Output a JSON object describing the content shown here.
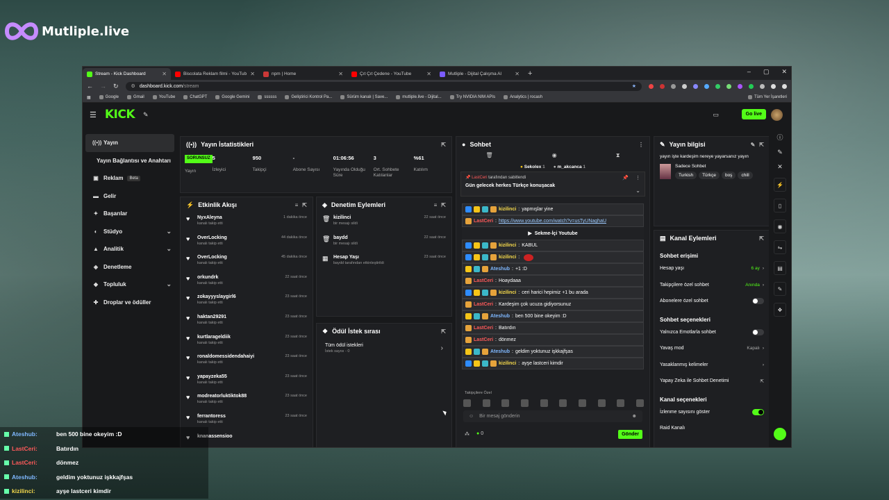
{
  "brand": {
    "name": "Mutliple.live"
  },
  "browser": {
    "tabs": [
      {
        "label": "Stream - Kick Dashboard",
        "color": "#53fc18",
        "active": true
      },
      {
        "label": "Biscolata Reklam filmi - YouTub",
        "color": "#ff0000",
        "active": false
      },
      {
        "label": "npm | Home",
        "color": "#cb3837",
        "active": false
      },
      {
        "label": "Çıt Çıt Çedene - YouTube",
        "color": "#ff0000",
        "active": false
      },
      {
        "label": "Mutliple - Dijital Çalışma Al",
        "color": "#7b5cff",
        "active": false
      }
    ],
    "url": "dashboard.kick.com",
    "url_path": "/stream",
    "bookmarks": [
      "Google",
      "Gmail",
      "YouTube",
      "ChatGPT",
      "Google Gemini",
      "ssssss",
      "Geliştirici Kontrol Pa...",
      "Sürüm kanalı | Save...",
      "mutliple.live - Dijital...",
      "Try NVIDIA NIM APIs",
      "Analytics | rocash"
    ],
    "bookmarks_all": "Tüm Yer İşaretleri"
  },
  "kick": {
    "logo": "KICK",
    "golive": "Go live",
    "sidebar": [
      {
        "label": "Yayın",
        "icon": "broadcast-icon",
        "active": true
      },
      {
        "label": "Yayın Bağlantısı ve Anahtarı",
        "icon": "",
        "active": false
      },
      {
        "label": "Reklam",
        "icon": "ad-icon",
        "beta": "Beta"
      },
      {
        "label": "Gelir",
        "icon": "revenue-icon"
      },
      {
        "label": "Başarılar",
        "icon": "achievement-icon"
      },
      {
        "label": "Stüdyo",
        "icon": "studio-icon",
        "chev": true
      },
      {
        "label": "Analitik",
        "icon": "analytics-icon",
        "chev": true
      },
      {
        "label": "Denetleme",
        "icon": "moderation-icon"
      },
      {
        "label": "Topluluk",
        "icon": "community-icon",
        "chev": true
      },
      {
        "label": "Droplar ve ödüller",
        "icon": "drops-icon"
      }
    ]
  },
  "stats": {
    "title": "Yayın İstatistikleri",
    "badge": "SORUNSUZ",
    "badge_label": "Yayın",
    "items": [
      {
        "value": "5",
        "label": "İzleyici"
      },
      {
        "value": "950",
        "label": "Takipçi"
      },
      {
        "value": "-",
        "label": "Abone Sayısı"
      },
      {
        "value": "01:06:56",
        "label": "Yayında Olduğu Süre"
      },
      {
        "value": "3",
        "label": "Ort. Sohbete Katılanlar"
      },
      {
        "value": "%61",
        "label": "Katılım"
      }
    ]
  },
  "activity": {
    "title": "Etkinlik Akışı",
    "items": [
      {
        "name": "NyxAleyna",
        "sub": "kanalı takip etti",
        "time": "1 dakika önce"
      },
      {
        "name": "OverLocking",
        "sub": "kanalı takip etti",
        "time": "44 dakika önce"
      },
      {
        "name": "OverLocking",
        "sub": "kanalı takip etti",
        "time": "45 dakika önce"
      },
      {
        "name": "orkundrk",
        "sub": "kanalı takip etti",
        "time": "22 saat önce"
      },
      {
        "name": "zokayyyslaygirl6",
        "sub": "kanalı takip etti",
        "time": "23 saat önce"
      },
      {
        "name": "haktan29291",
        "sub": "kanalı takip etti",
        "time": "23 saat önce"
      },
      {
        "name": "kurtlarageldiik",
        "sub": "kanalı takip etti",
        "time": "23 saat önce"
      },
      {
        "name": "ronaldomessidendahaiyi",
        "sub": "kanalı takip etti",
        "time": "23 saat önce"
      },
      {
        "name": "yapayzeka55",
        "sub": "kanalı takip etti",
        "time": "23 saat önce"
      },
      {
        "name": "modreatorluktiktok88",
        "sub": "kanalı takip etti",
        "time": "23 saat önce"
      },
      {
        "name": "ferrantoress",
        "sub": "kanalı takip etti",
        "time": "23 saat önce"
      },
      {
        "name": "knanassensioo",
        "sub": "",
        "time": ""
      }
    ]
  },
  "moderation": {
    "title": "Denetim Eylemleri",
    "items": [
      {
        "name": "kizilinci",
        "sub": "bir mesajı sildi",
        "time": "22 saat önce",
        "icon": "trash-icon"
      },
      {
        "name": "baydd",
        "sub": "bir mesajı sildi",
        "time": "22 saat önce",
        "icon": "trash-icon"
      },
      {
        "name": "Hesap Yaşı",
        "sub": "baydd tarafından etkinleştirildi",
        "time": "23 saat önce",
        "icon": "calendar-icon"
      }
    ]
  },
  "rewards": {
    "title": "Ödül İstek sırası",
    "item": "Tüm ödül istekleri",
    "sub": "İstek sayısı - 0"
  },
  "chat": {
    "title": "Sohbet",
    "top_users": [
      "Sekolex",
      "m_akcanca"
    ],
    "top_counts": [
      "1",
      "1"
    ],
    "pinned_by": "LastCeri",
    "pinned_suffix": "tarafından sabitlendi",
    "pinned_msg": "Gün gelecek herkes Türkçe konuşacak",
    "messages": [
      {
        "user": "kizilinci",
        "text": "yapmışlar yine",
        "color": "#f5d94b",
        "badges": 4
      },
      {
        "user": "LastCeri",
        "text": "https://www.youtube.com/watch?v=usTyUNaghaU",
        "color": "#ff5a5a",
        "badges": 1,
        "link": true
      },
      {
        "user": "kizilinci",
        "text": "KABUL",
        "color": "#f5d94b",
        "badges": 4
      },
      {
        "user": "kizilinci",
        "text": "",
        "color": "#f5d94b",
        "badges": 4
      },
      {
        "user": "Ateshub",
        "text": "+1 :D",
        "color": "#7fb8ff",
        "badges": 3
      },
      {
        "user": "LastCeri",
        "text": "Hoaydaaa",
        "color": "#ff5a5a",
        "badges": 1
      },
      {
        "user": "kizilinci",
        "text": "ceri harici hepimiz +1 bu arada",
        "color": "#f5d94b",
        "badges": 4
      },
      {
        "user": "LastCeri",
        "text": "Kardeşim çok ucuza gidiyorsunuz",
        "color": "#ff5a5a",
        "badges": 1
      },
      {
        "user": "Ateshub",
        "text": "ben 500 bine okeyim :D",
        "color": "#7fb8ff",
        "badges": 3
      },
      {
        "user": "LastCeri",
        "text": "Batırdın",
        "color": "#ff5a5a",
        "badges": 1
      },
      {
        "user": "LastCeri",
        "text": "dönmez",
        "color": "#ff5a5a",
        "badges": 1
      },
      {
        "user": "Ateshub",
        "text": "geldim yoktunuz işkkajfşas",
        "color": "#7fb8ff",
        "badges": 3
      },
      {
        "user": "kizilinci",
        "text": "ayşe lastceri kimdir",
        "color": "#f5d94b",
        "badges": 4
      }
    ],
    "youtube_btn": "Sekme-İçi Youtube",
    "emote_label": "Takipçilere Özel",
    "placeholder": "Bir mesaj gönderin",
    "viewers": "0",
    "send": "Gönder"
  },
  "stream_info": {
    "title": "Yayın bilgisi",
    "stream_title": "yayın işte kardeşim nereye yayarsanız yayın",
    "category": "Sadece Sohbet",
    "tags": [
      "Turkish",
      "Türkçe",
      "boş",
      "chill"
    ]
  },
  "channel_actions": {
    "title": "Kanal Eylemleri",
    "access_title": "Sohbet erişimi",
    "rows1": [
      {
        "label": "Hesap yaşı",
        "value": "6 ay",
        "type": "link"
      },
      {
        "label": "Takipçilere özel sohbet",
        "value": "Anında",
        "type": "link"
      },
      {
        "label": "Abonelere özel sohbet",
        "value": "",
        "type": "toggle"
      }
    ],
    "options_title": "Sohbet seçenekleri",
    "rows2": [
      {
        "label": "Yalnızca Emotlarla sohbet",
        "value": "",
        "type": "toggle"
      },
      {
        "label": "Yavaş mod",
        "value": "Kapalı",
        "type": "link-grey"
      },
      {
        "label": "Yasaklanmış kelimeler",
        "value": "",
        "type": "link-grey"
      },
      {
        "label": "Yapay Zeka ile Sohbet Denetimi",
        "value": "",
        "type": "ext"
      }
    ],
    "channel_title": "Kanal seçenekleri",
    "rows3": [
      {
        "label": "İzlenme sayısını göster",
        "value": "",
        "type": "toggle-on"
      },
      {
        "label": "Raid Kanalı",
        "value": "",
        "type": "none"
      }
    ]
  },
  "overlay": [
    {
      "user": "Ateshub:",
      "text": "ben 500 bine okeyim :D",
      "color": "#7fb8ff"
    },
    {
      "user": "LastCeri:",
      "text": "Batırdın",
      "color": "#ff5a5a"
    },
    {
      "user": "LastCeri:",
      "text": "dönmez",
      "color": "#ff5a5a"
    },
    {
      "user": "Ateshub:",
      "text": "geldim yoktunuz işkkajfşas",
      "color": "#7fb8ff"
    },
    {
      "user": "kizilinci:",
      "text": "ayşe lastceri kimdir",
      "color": "#f5d94b"
    }
  ]
}
